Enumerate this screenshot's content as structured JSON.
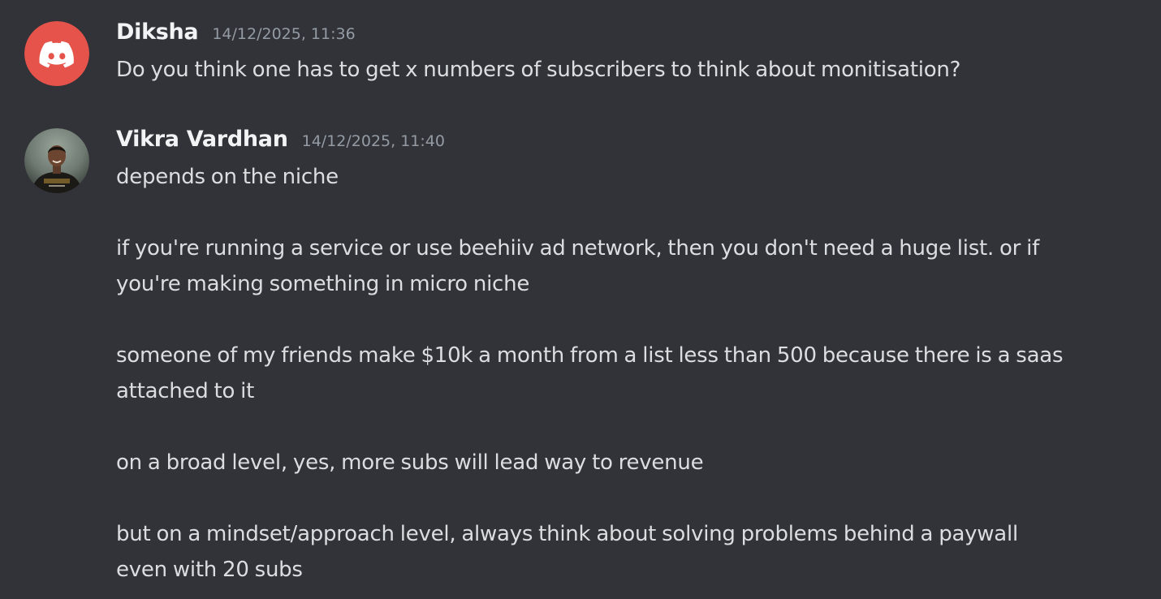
{
  "messages": [
    {
      "author": "Diksha",
      "timestamp": "14/12/2025, 11:36",
      "avatar_icon": "discord-logo-icon",
      "avatar_color": "#e5534b",
      "lines": [
        "Do you think one has to get x numbers of subscribers to think about monitisation?"
      ]
    },
    {
      "author": "Vikra Vardhan",
      "timestamp": "14/12/2025, 11:40",
      "avatar_icon": "user-photo-avatar",
      "lines": [
        "depends on the niche",
        "",
        "if you're running a service or use beehiiv ad network, then you don't need a huge list. or if",
        "you're making something in micro niche",
        "",
        "someone of my friends make $10k a month from a list less than 500 because there is a saas",
        "attached to it",
        "",
        "on a broad level, yes, more subs will lead way to revenue",
        "",
        "but on a mindset/approach level, always think about solving problems behind a paywall",
        "even with 20 subs"
      ]
    }
  ],
  "theme": {
    "background": "#313338",
    "text": "#dbdee1",
    "username": "#f2f3f5",
    "timestamp": "#949ba4"
  }
}
